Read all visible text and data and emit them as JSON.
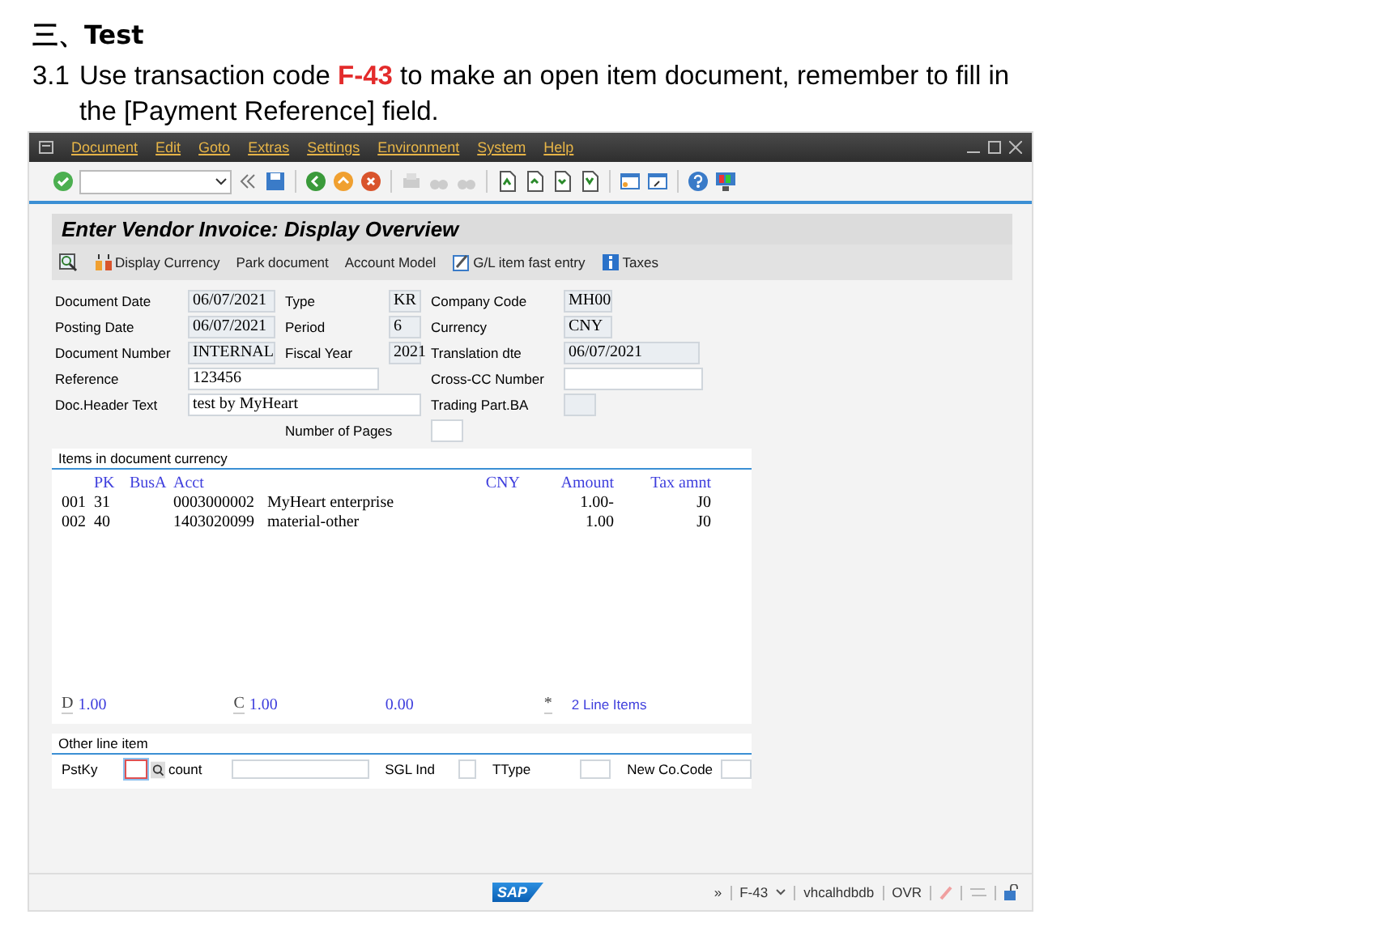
{
  "heading": "三、Test",
  "instruction": {
    "number": "3.1",
    "text": "Use transaction code **F-43** to make an open item document, remember to fill in the [Payment Reference] field."
  },
  "window": {
    "menu": [
      "Document",
      "Edit",
      "Goto",
      "Extras",
      "Settings",
      "Environment",
      "System",
      "Help"
    ],
    "title": "Enter Vendor Invoice: Display Overview",
    "app_toolbar": [
      {
        "kind": "icon"
      },
      {
        "kind": "icon-text",
        "label": "Display Currency"
      },
      {
        "kind": "text",
        "label": "Park document"
      },
      {
        "kind": "text",
        "label": "Account Model"
      },
      {
        "kind": "icon-text",
        "label": "G/L item fast entry"
      },
      {
        "kind": "icon-text",
        "label": "Taxes"
      }
    ],
    "header_rows": [
      {
        "left": {
          "label": "Document Date",
          "value": "06/07/2021",
          "kind": "display"
        },
        "mid": {
          "label": "Type",
          "value": "KR",
          "kind": "display"
        },
        "right": {
          "label": "Company Code",
          "value": "MH00",
          "kind": "display"
        }
      },
      {
        "left": {
          "label": "Posting Date",
          "value": "06/07/2021",
          "kind": "display"
        },
        "mid": {
          "label": "Period",
          "value": "6",
          "kind": "display"
        },
        "right": {
          "label": "Currency",
          "value": "CNY",
          "kind": "display"
        }
      },
      {
        "left": {
          "label": "Document Number",
          "value": "INTERNAL",
          "kind": "display"
        },
        "mid": {
          "label": "Fiscal Year",
          "value": "2021",
          "kind": "display"
        },
        "right": {
          "label": "Translation dte",
          "value": "06/07/2021",
          "kind": "display"
        }
      },
      {
        "left": {
          "label": "Reference",
          "value": "123456",
          "kind": "input"
        },
        "right": {
          "label": "Cross-CC Number",
          "kind": "input"
        }
      },
      {
        "left": {
          "label": "Doc.Header Text",
          "value": "test by MyHeart",
          "kind": "input"
        },
        "right": {
          "label": "Trading Part.BA",
          "kind": "display"
        }
      },
      {
        "mid": {
          "label": "Number of Pages",
          "kind": "input"
        }
      }
    ],
    "items": {
      "title": "Items in document currency",
      "columns": {
        "pk": "PK",
        "business_area": "BusA",
        "account": "Acct",
        "currency": "CNY",
        "amount": "Amount",
        "tax": "Tax amnt"
      },
      "rows": [
        {
          "no": "001",
          "pk": "31",
          "account": "0003000002",
          "text": "MyHeart enterprise",
          "amount": "1.00-",
          "tax": "J0"
        },
        {
          "no": "002",
          "pk": "40",
          "account": "1403020099",
          "text": "material-other",
          "amount": "1.00",
          "tax": "J0"
        }
      ],
      "totals": {
        "debit_label": "D",
        "debit": "1.00",
        "credit_label": "C",
        "credit": "1.00",
        "balance": "0.00",
        "marker": "*",
        "line_items": "2 Line Items"
      }
    },
    "other_line_item": {
      "title": "Other line item",
      "fields": [
        {
          "label": "PstKy",
          "focused": true,
          "kind": "key"
        },
        {
          "label": "count",
          "focused": false,
          "kind": "search"
        },
        {
          "label": "SGL Ind",
          "focused": false,
          "kind": "small"
        },
        {
          "label": "TType",
          "focused": false,
          "kind": "small"
        },
        {
          "label": "New Co.Code",
          "focused": false,
          "kind": "small"
        }
      ]
    },
    "status_bar": {
      "logo": "SAP",
      "more": "»",
      "transaction": "F-43",
      "system": "vhcalhdbdb",
      "mode": "OVR"
    }
  }
}
